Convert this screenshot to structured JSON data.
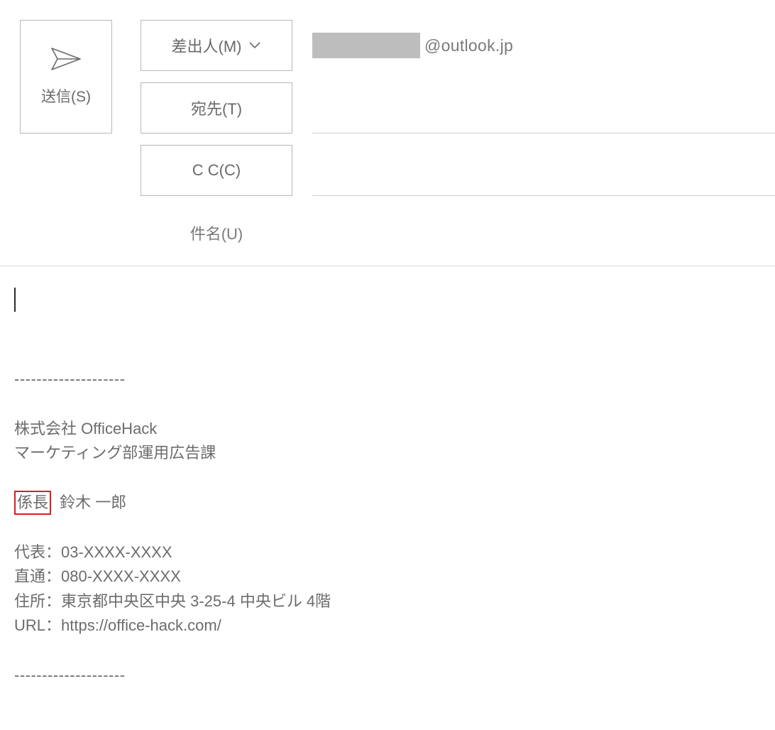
{
  "send": {
    "label": "送信(S)"
  },
  "from": {
    "label": "差出人(M)",
    "email_domain": "@outlook.jp"
  },
  "to": {
    "label": "宛先(T)",
    "value": ""
  },
  "cc": {
    "label": "C C(C)",
    "value": ""
  },
  "subject": {
    "label": "件名(U)",
    "value": ""
  },
  "signature": {
    "dashes": "--------------------",
    "company": "株式会社 OfficeHack",
    "department": "マーケティング部運用広告課",
    "title": "係長",
    "name": "鈴木 一郎",
    "tel_main": "代表：03-XXXX-XXXX",
    "tel_direct": "直通：080-XXXX-XXXX",
    "address": "住所：東京都中央区中央 3-25-4 中央ビル 4階",
    "url": "URL：https://office-hack.com/"
  }
}
